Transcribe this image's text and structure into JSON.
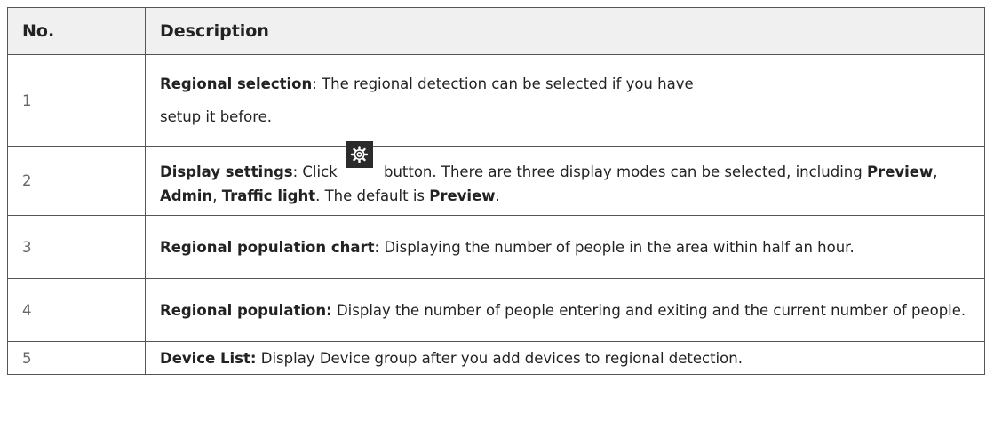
{
  "table": {
    "headers": {
      "no": "No.",
      "description": "Description"
    },
    "rows": [
      {
        "no": "1",
        "term": "Regional selection",
        "sep": ": ",
        "text": "The regional detection can be selected if you have",
        "text2": "setup it before."
      },
      {
        "no": "2",
        "term": "Display settings",
        "sep": ": ",
        "before_icon": "Click ",
        "icon": "gear-icon",
        "after_icon": "button. There are three display modes can be selected, including ",
        "mode1": "Preview",
        "comma1": ", ",
        "mode2": "Admin",
        "comma2": ", ",
        "mode3": "Traffic light",
        "mid": ". The default is ",
        "default": "Preview",
        "end": "."
      },
      {
        "no": "3",
        "term": "Regional population chart",
        "sep": ": ",
        "text": "Displaying the number of people in the area within half an hour."
      },
      {
        "no": "4",
        "term": "Regional population:",
        "sep": " ",
        "text": "Display the number of people entering and exiting and the current number of people."
      },
      {
        "no": "5",
        "term": "Device List:",
        "sep": " ",
        "text": "Display Device group after you add devices to regional detection."
      }
    ]
  }
}
